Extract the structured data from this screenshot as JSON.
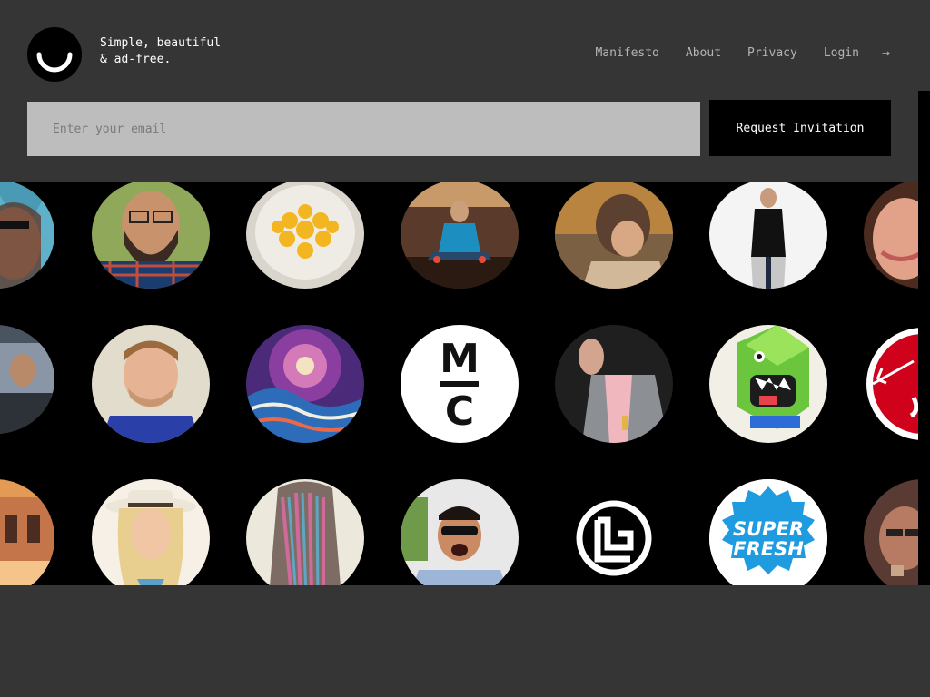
{
  "brand": {
    "tagline_line1": "Simple, beautiful",
    "tagline_line2": "& ad-free."
  },
  "nav": {
    "items": [
      "Manifesto",
      "About",
      "Privacy",
      "Login"
    ],
    "arrow_icon": "arrow-right-icon"
  },
  "signup": {
    "email_placeholder": "Enter your email",
    "button_label": "Request Invitation"
  },
  "avatars": {
    "mc_logo_top": "M",
    "mc_logo_bottom": "C",
    "superfresh_line1": "SUPER",
    "superfresh_line2": "FRESH"
  },
  "colors": {
    "background": "#353535",
    "grid_background": "#000000",
    "input_background": "#bdbdbd",
    "superfresh_blue": "#1f9be0",
    "red_logo": "#d0021b"
  }
}
